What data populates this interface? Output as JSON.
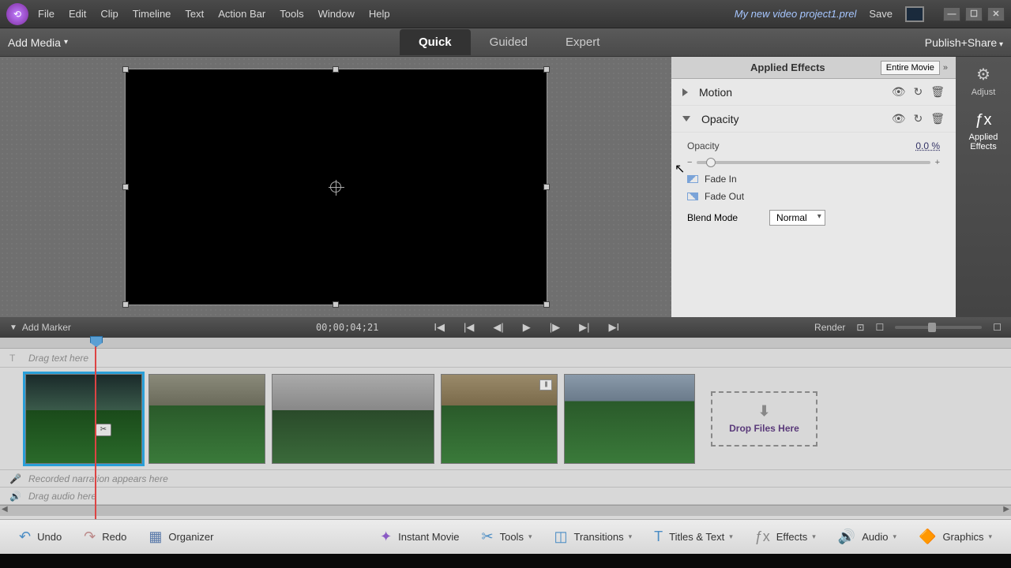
{
  "menu": [
    "File",
    "Edit",
    "Clip",
    "Timeline",
    "Text",
    "Action Bar",
    "Tools",
    "Window",
    "Help"
  ],
  "project_title": "My new video project1.prel",
  "save": "Save",
  "modebar": {
    "add_media": "Add Media",
    "quick": "Quick",
    "guided": "Guided",
    "expert": "Expert",
    "publish": "Publish+Share"
  },
  "playbar": {
    "add_marker": "Add Marker",
    "timecode": "00;00;04;21",
    "render": "Render"
  },
  "effects": {
    "title": "Applied Effects",
    "entire": "Entire Movie",
    "motion": "Motion",
    "opacity": "Opacity",
    "opacity_label": "Opacity",
    "opacity_value": "0.0 %",
    "fade_in": "Fade In",
    "fade_out": "Fade Out",
    "blend_label": "Blend Mode",
    "blend_value": "Normal"
  },
  "sidetabs": {
    "adjust": "Adjust",
    "applied": "Applied Effects"
  },
  "tracks": {
    "text_placeholder": "Drag text here",
    "narration_placeholder": "Recorded narration appears here",
    "audio_placeholder": "Drag audio here",
    "drop_zone": "Drop Files Here"
  },
  "bottom": {
    "undo": "Undo",
    "redo": "Redo",
    "organizer": "Organizer",
    "instant": "Instant Movie",
    "tools": "Tools",
    "transitions": "Transitions",
    "titles": "Titles & Text",
    "effects": "Effects",
    "audio": "Audio",
    "graphics": "Graphics"
  }
}
